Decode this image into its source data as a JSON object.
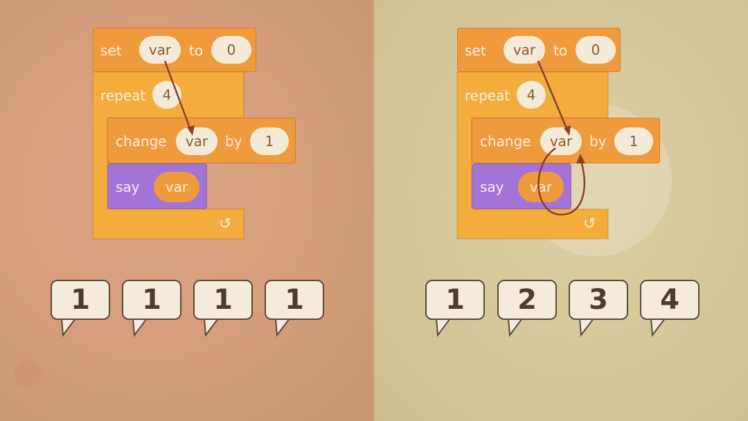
{
  "program": {
    "set_label": "set",
    "var_name": "var",
    "to_label": "to",
    "initial_value": "0",
    "repeat_label": "repeat",
    "repeat_count": "4",
    "change_label": "change",
    "by_label": "by",
    "increment": "1",
    "say_label": "say",
    "loop_arrow_glyph": "↺"
  },
  "left_outputs": [
    "1",
    "1",
    "1",
    "1"
  ],
  "right_outputs": [
    "1",
    "2",
    "3",
    "4"
  ],
  "colors": {
    "left_background": "#d69e7c",
    "right_background": "#d6c89b",
    "orange_block": "#f09a3e",
    "yellow_block": "#f4ad3d",
    "purple_block": "#a374d8",
    "arrow": "#8a3f2c"
  }
}
